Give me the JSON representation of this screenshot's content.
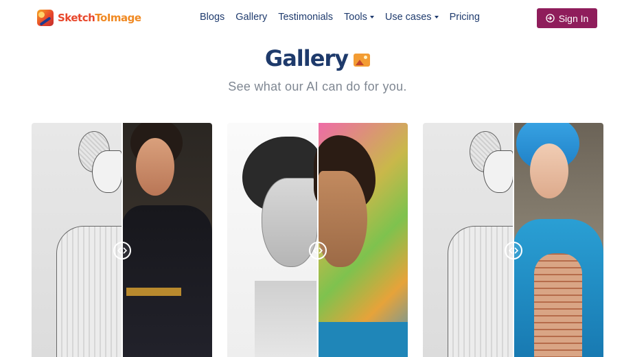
{
  "header": {
    "logo_text_a": "Sketch",
    "logo_text_b": "ToImage",
    "nav": [
      {
        "label": "Blogs",
        "dropdown": false
      },
      {
        "label": "Gallery",
        "dropdown": false
      },
      {
        "label": "Testimonials",
        "dropdown": false
      },
      {
        "label": "Tools",
        "dropdown": true
      },
      {
        "label": "Use cases",
        "dropdown": true
      },
      {
        "label": "Pricing",
        "dropdown": false
      }
    ],
    "signin_label": "Sign In"
  },
  "hero": {
    "title": "Gallery",
    "subtitle": "See what our AI can do for you."
  },
  "gallery": {
    "cards": [
      {
        "name": "woman-saree-black",
        "left": "sketch",
        "right": "color"
      },
      {
        "name": "short-hair-portrait",
        "left": "sketch",
        "right": "color"
      },
      {
        "name": "woman-blue-hair",
        "left": "sketch",
        "right": "color"
      }
    ]
  },
  "colors": {
    "brand_primary": "#8f1d5b",
    "title": "#1e3a6b",
    "nav_text": "#1f3b6e",
    "subtitle": "#7f8792",
    "logo_red": "#e8472b",
    "logo_orange": "#f08a24"
  },
  "icons": {
    "signin": "login-arrow-icon",
    "gallery": "picture-icon",
    "dropdown": "caret-down-icon",
    "slider": "compare-arrows-icon"
  }
}
